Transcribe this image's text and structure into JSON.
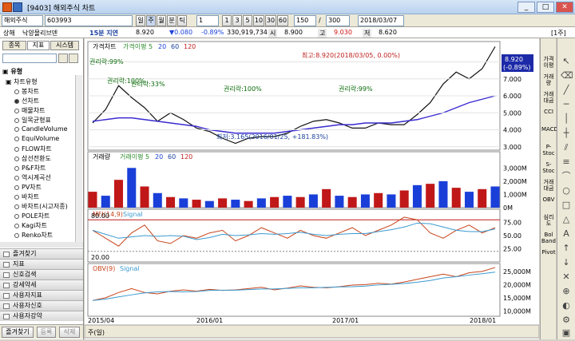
{
  "window": {
    "title": "[9403] 해외주식 차트",
    "min": "_",
    "max": "□",
    "close": "✕"
  },
  "toolbar": {
    "market": "해외주식",
    "code": "603993",
    "btn_day": "일",
    "btn_week": "주",
    "btn_month": "월",
    "btn_min": "분",
    "btn_tick": "틱",
    "period_value": "1",
    "btn_1": "1",
    "btn_3": "3",
    "btn_5": "5",
    "btn_10": "10",
    "btn_30": "30",
    "btn_60": "60",
    "count": "150",
    "slash": "/",
    "total": "300",
    "date": "2018/03/07"
  },
  "infobar": {
    "exchange": "상해",
    "name": "낙양몰리브덴",
    "delay": "15분 지연",
    "price": "8.920",
    "change": "▼0.080",
    "change_pct": "-0.89%",
    "volume": "330,919,734",
    "open_label": "시",
    "open": "8.900",
    "high_label": "고",
    "high": "9.030",
    "low_label": "저",
    "low": "8.620",
    "unit": "[1주]"
  },
  "leftpanel": {
    "tabs": [
      "종목",
      "지표",
      "시스템"
    ],
    "tree_header": "유형",
    "chart_type_label": "차트유형",
    "items": [
      "봉차트",
      "선차트",
      "매물차트",
      "일목균형표",
      "CandleVolume",
      "EquiVolume",
      "FLOW차트",
      "삼선전환도",
      "P&F차트",
      "역시계곡선",
      "PV차트",
      "바차트",
      "바차트(시고저종)",
      "POLE차트",
      "Kagi차트",
      "Renko차트"
    ],
    "sections": [
      "즐겨찾기",
      "지표",
      "신호검색",
      "강세약세",
      "사용자지표",
      "사용자신호",
      "사용자강약"
    ],
    "footer_btns": [
      "즐겨찾기",
      "등록",
      "삭제"
    ]
  },
  "chart": {
    "price_legend": [
      "가격차트",
      "가격이평 5",
      "20",
      "60",
      "120"
    ],
    "max_annotation": "최고:8.920(2018/03/05, 0.00%)",
    "min_annotation": "최저:3.165(2016/01/25, +181.83%)",
    "rights_labels": [
      "권리락:99%",
      "권리락:100%",
      "권리락:33%",
      "권리락:100%",
      "권리락:99%"
    ],
    "price_axis": [
      "8.000",
      "7.000",
      "6.000",
      "5.000",
      "4.000",
      "3.000"
    ],
    "last_price": "8.920",
    "last_pct": "(-0.89%)",
    "volume_legend": [
      "거래량",
      "거래이평 5",
      "20",
      "60",
      "120"
    ],
    "volume_axis": [
      "3,000M",
      "2,000M",
      "1,000M",
      "0M"
    ],
    "mfi_legend": [
      "MFI(14,9)",
      "Signal"
    ],
    "mfi_levels": [
      "80.00",
      "20.00"
    ],
    "mfi_axis": [
      "75.00",
      "50.00",
      "25.00"
    ],
    "obv_legend": [
      "OBV(9)",
      "Signal"
    ],
    "obv_axis": [
      "25,000M",
      "20,000M",
      "15,000M",
      "10,000M"
    ],
    "x_axis": [
      "2015/04",
      "2016/01",
      "2017/01",
      "2018/01"
    ],
    "period_label": "주(일)"
  },
  "rightbar": [
    "가격이평",
    "거래량",
    "거래대금",
    "CCI",
    "MACD",
    "P-Stoc",
    "S-Stoc",
    "거래대금",
    "OBV",
    "심리도",
    "Bol Band",
    "Pivot"
  ],
  "chart_data": {
    "type": "line",
    "title": "가격차트",
    "x_range": [
      "2015/04",
      "2018/03"
    ],
    "ylim": [
      2.8,
      9.2
    ],
    "series": [
      {
        "name": "가격차트",
        "values": [
          4.4,
          5.2,
          6.6,
          5.9,
          5.3,
          4.5,
          5.0,
          4.6,
          4.1,
          3.9,
          3.5,
          3.2,
          3.5,
          3.6,
          3.6,
          3.8,
          4.2,
          4.5,
          4.6,
          4.4,
          4.1,
          4.1,
          4.4,
          4.3,
          4.3,
          4.9,
          5.6,
          6.7,
          7.4,
          7.0,
          7.6,
          8.9
        ]
      },
      {
        "name": "120",
        "values": [
          4.5,
          4.6,
          4.7,
          4.7,
          4.6,
          4.5,
          4.4,
          4.3,
          4.2,
          4.0,
          3.9,
          3.8,
          3.8,
          3.8,
          3.8,
          3.9,
          4.0,
          4.1,
          4.2,
          4.3,
          4.3,
          4.4,
          4.4,
          4.4,
          4.5,
          4.6,
          4.8,
          5.0,
          5.3,
          5.6,
          5.8,
          6.0
        ]
      }
    ],
    "volume_values": [
      1.2,
      0.9,
      2.1,
      3.0,
      1.6,
      1.1,
      0.8,
      0.7,
      0.6,
      0.5,
      0.7,
      0.6,
      0.5,
      0.7,
      0.8,
      0.9,
      0.8,
      1.0,
      1.4,
      0.9,
      0.8,
      1.0,
      1.1,
      1.0,
      1.3,
      1.7,
      1.8,
      2.0,
      1.5,
      1.2,
      1.4,
      1.6
    ],
    "mfi_values": [
      60,
      45,
      30,
      55,
      70,
      40,
      35,
      50,
      45,
      55,
      60,
      40,
      50,
      65,
      55,
      45,
      60,
      50,
      45,
      55,
      65,
      50,
      60,
      70,
      85,
      80,
      55,
      45,
      60,
      70,
      55,
      65
    ],
    "obv_values": [
      14000,
      15000,
      17000,
      18500,
      17000,
      16500,
      17500,
      18000,
      17500,
      18200,
      17800,
      18000,
      18500,
      19000,
      18000,
      18700,
      19500,
      19000,
      18800,
      19200,
      19800,
      20000,
      20500,
      20200,
      21000,
      22000,
      23000,
      24000,
      23000,
      24500,
      25000,
      26500
    ]
  }
}
